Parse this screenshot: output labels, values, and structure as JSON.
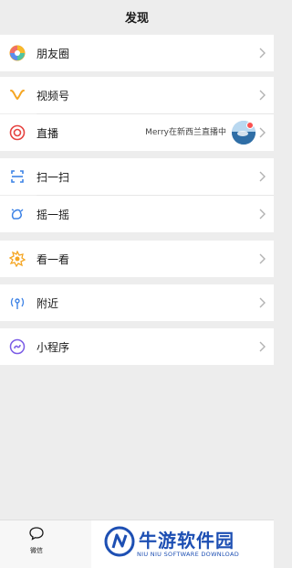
{
  "header": {
    "title": "发现"
  },
  "menu": {
    "moments": "朋友圈",
    "channels": "视频号",
    "live": {
      "label": "直播",
      "subtitle": "Merry在新西兰直播中"
    },
    "scan": "扫一扫",
    "shake": "摇一摇",
    "top_stories": "看一看",
    "nearby": "附近",
    "mini_programs": "小程序"
  },
  "tabbar": {
    "chats": "微信"
  },
  "watermark": {
    "title": "牛游软件园",
    "subtitle": "NIU NIU SOFTWARE DOWNLOAD"
  },
  "colors": {
    "background": "#ededed",
    "cell": "#ffffff",
    "brand": "#1d4fb3",
    "badge": "#fa5151"
  }
}
